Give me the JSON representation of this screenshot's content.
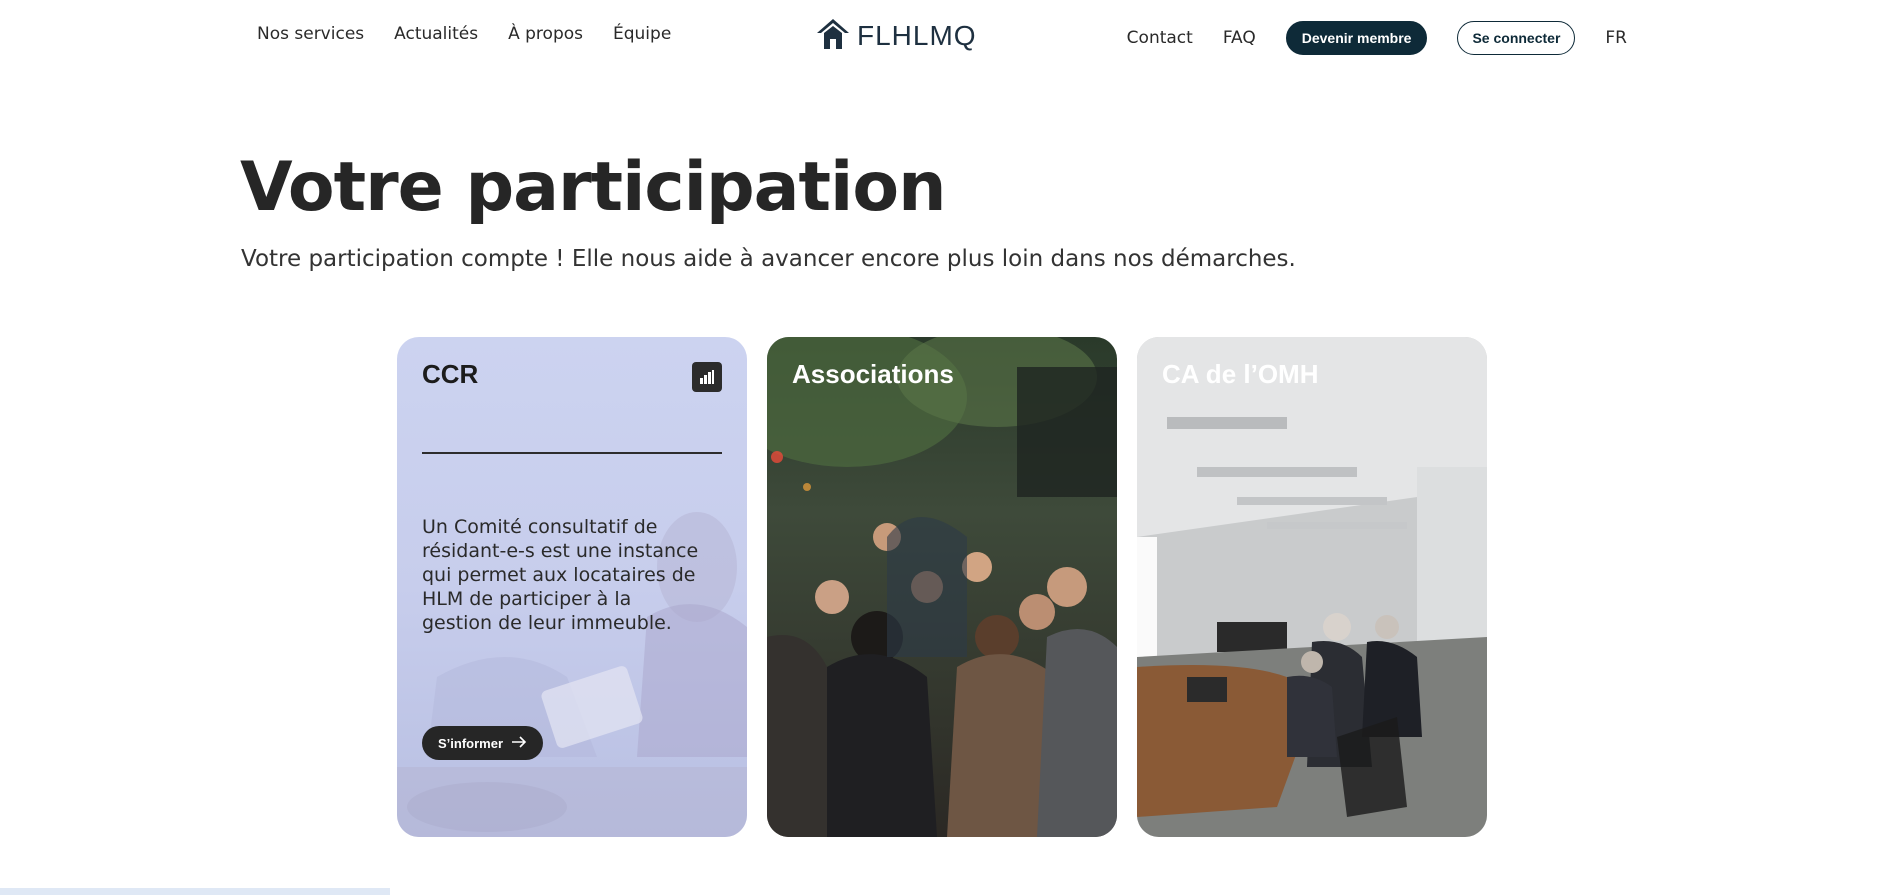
{
  "nav": {
    "left_links": [
      "Nos services",
      "Actualités",
      "À propos",
      "Équipe"
    ],
    "logo_text": "FLHLMQ",
    "contact": "Contact",
    "faq": "FAQ",
    "become_member": "Devenir membre",
    "login": "Se connecter",
    "language": "FR"
  },
  "hero": {
    "title": "Votre participation",
    "subtitle": "Votre participation compte ! Elle nous aide à avancer encore plus loin dans nos démarches."
  },
  "cards": [
    {
      "title": "CCR",
      "icon": "building-icon",
      "description": "Un Comité consultatif de résidant-e-s est une instance qui permet aux locataires de HLM de participer à la gestion de leur immeuble.",
      "button_label": "S’informer",
      "button_icon": "arrow-right-icon"
    },
    {
      "title": "Associations"
    },
    {
      "title": "CA de l’OMH"
    }
  ],
  "colors": {
    "brand_dark": "#0e2a38",
    "ccr_card": "#ccd3f0",
    "text_dark": "#262626"
  }
}
